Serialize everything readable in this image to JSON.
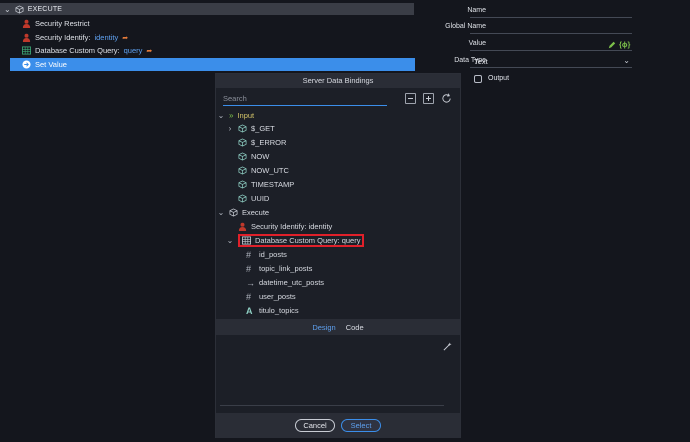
{
  "tree": {
    "execute_label": "EXECUTE",
    "steps": [
      {
        "label": "Security Restrict",
        "icon": "user-icon"
      },
      {
        "label": "Security Identify:",
        "accent": "identity",
        "icon": "user-icon"
      },
      {
        "label": "Database Custom Query:",
        "accent": "query",
        "icon": "table-icon"
      },
      {
        "label": "Set Value",
        "icon": "arrow-circle-icon"
      }
    ]
  },
  "props": {
    "name_label": "Name",
    "global_name_label": "Global Name",
    "value_label": "Value",
    "data_type_label": "Data Type",
    "data_type_value": "Text",
    "output_label": "Output"
  },
  "dialog": {
    "title": "Server Data Bindings",
    "search_placeholder": "Search",
    "input_label": "Input",
    "input_items": [
      "$_GET",
      "$_ERROR",
      "NOW",
      "NOW_UTC",
      "TIMESTAMP",
      "UUID"
    ],
    "execute_label": "Execute",
    "security_identify": "Security Identify: identity",
    "db_query": "Database Custom Query: query",
    "fields": [
      {
        "label": "id_posts",
        "icon": "hash-icon"
      },
      {
        "label": "topic_link_posts",
        "icon": "hash-icon"
      },
      {
        "label": "datetime_utc_posts",
        "icon": "arrow-right-icon"
      },
      {
        "label": "user_posts",
        "icon": "hash-icon"
      },
      {
        "label": "titulo_topics",
        "icon": "text-a-icon"
      }
    ],
    "tab_design": "Design",
    "tab_code": "Code",
    "cancel_label": "Cancel",
    "select_label": "Select"
  },
  "colors": {
    "accent": "#3b8eea",
    "highlight": "#e0202a",
    "background": "#14161d"
  }
}
